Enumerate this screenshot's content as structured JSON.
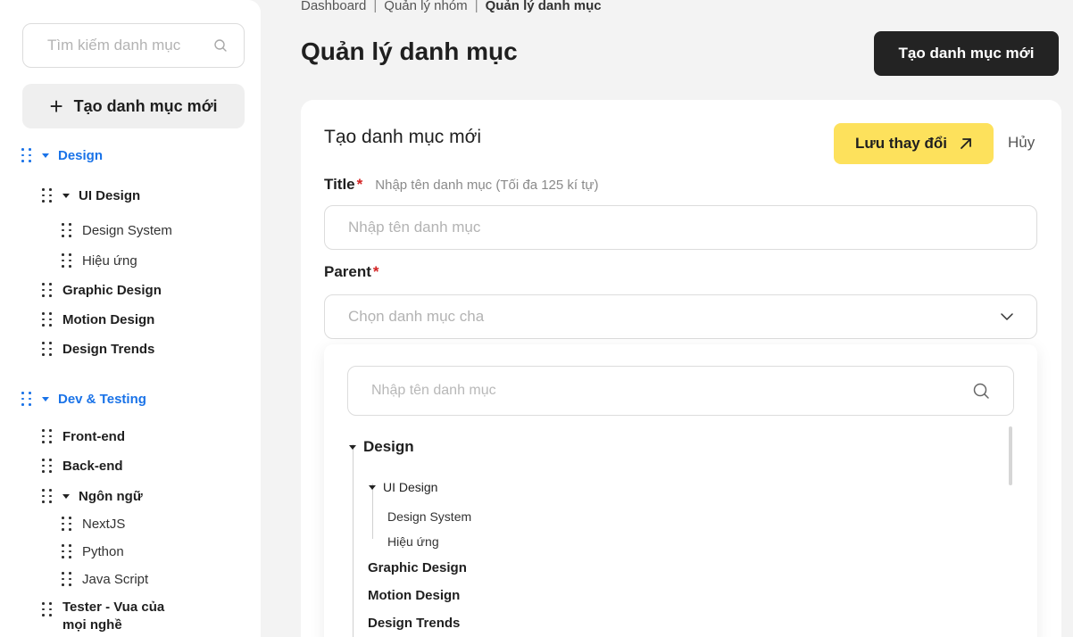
{
  "sidebar": {
    "search_placeholder": "Tìm kiếm danh mục",
    "create_label": "Tạo danh mục mới",
    "tree": {
      "g1": "Design",
      "g1_c1": "UI Design",
      "g1_c1_a": "Design System",
      "g1_c1_b": "Hiệu ứng",
      "g1_c2": "Graphic Design",
      "g1_c3": "Motion Design",
      "g1_c4": "Design Trends",
      "g2": "Dev & Testing",
      "g2_c1": "Front-end",
      "g2_c2": "Back-end",
      "g2_c3": "Ngôn ngữ",
      "g2_c3_a": "NextJS",
      "g2_c3_b": "Python",
      "g2_c3_c": "Java Script",
      "g2_c4_line1": "Tester - Vua của",
      "g2_c4_line2": "mọi nghề"
    }
  },
  "breadcrumb": {
    "item1": "Dashboard",
    "item2": "Quản lý nhóm",
    "item3": "Quản lý danh mục",
    "separator": "|"
  },
  "header": {
    "title": "Quản lý danh mục",
    "create_button": "Tạo danh mục mới"
  },
  "form": {
    "title": "Tạo danh mục mới",
    "save_label": "Lưu thay đổi",
    "cancel_label": "Hủy",
    "title_field": {
      "label": "Title",
      "required_mark": "*",
      "hint": "Nhập tên danh mục (Tối đa 125 kí tự)",
      "placeholder": "Nhập tên danh mục"
    },
    "parent_field": {
      "label": "Parent",
      "required_mark": "*",
      "placeholder": "Chọn danh mục cha"
    },
    "dropdown": {
      "search_placeholder": "Nhập tên danh mục",
      "items": {
        "root": "Design",
        "c1": "UI Design",
        "c1_a": "Design System",
        "c1_b": "Hiệu ứng",
        "c2": "Graphic Design",
        "c3": "Motion Design",
        "c4": "Design Trends"
      }
    }
  },
  "colors": {
    "accent_blue": "#1a73e8",
    "save_yellow": "#fde15c",
    "dark_button": "#232323",
    "required_red": "#d32222"
  }
}
